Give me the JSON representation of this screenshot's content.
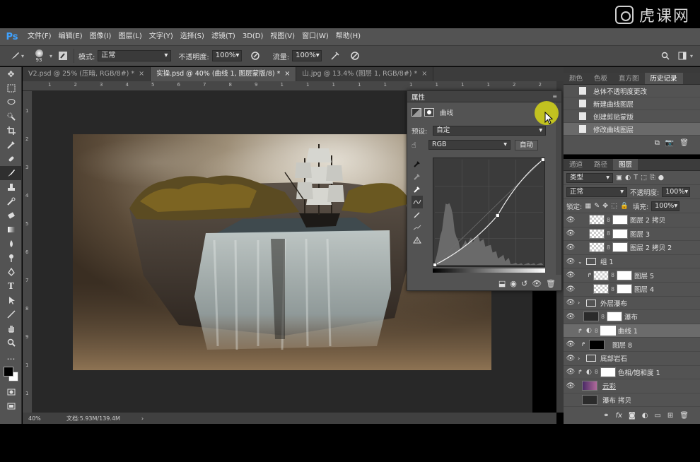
{
  "app": {
    "logo": "Ps",
    "watermark": "虎课网"
  },
  "menu": [
    "文件(F)",
    "编辑(E)",
    "图像(I)",
    "图层(L)",
    "文字(Y)",
    "选择(S)",
    "滤镜(T)",
    "3D(D)",
    "视图(V)",
    "窗口(W)",
    "帮助(H)"
  ],
  "options": {
    "brush_size": "93",
    "mode_label": "模式:",
    "mode_value": "正常",
    "opacity_label": "不透明度:",
    "opacity_value": "100%",
    "flow_label": "流量:",
    "flow_value": "100%"
  },
  "tabs": [
    {
      "label": "V2.psd @ 25% (压暗, RGB/8#) *",
      "close": "×"
    },
    {
      "label": "实操.psd @ 40% (曲线 1, 图层蒙版/8) *",
      "close": "×"
    },
    {
      "label": "山.jpg @ 13.4% (图层 1, RGB/8#) *",
      "close": "×"
    }
  ],
  "status": {
    "zoom": "40%",
    "doc": "文档:5.93M/139.4M",
    "arrow": "›"
  },
  "ruler": {
    "h": [
      "1",
      "2",
      "3",
      "4",
      "5",
      "6",
      "7",
      "8",
      "9",
      "1",
      "1",
      "1",
      "1",
      "1",
      "1",
      "1",
      "1",
      "1",
      "2",
      "2"
    ]
  },
  "properties": {
    "title": "属性",
    "type_label": "曲线",
    "preset_label": "预设:",
    "preset_value": "自定",
    "channel_value": "RGB",
    "auto_label": "自动",
    "curve_points": [
      [
        0,
        0
      ],
      [
        0.58,
        0.47
      ],
      [
        1,
        1
      ]
    ]
  },
  "history": {
    "tabs": [
      "颜色",
      "色板",
      "直方图",
      "历史记录"
    ],
    "items": [
      "总体不透明度更改",
      "新建曲线图层",
      "创建剪贴蒙版",
      "修改曲线图层"
    ]
  },
  "layers_panel": {
    "tabs": [
      "通道",
      "路径",
      "图层"
    ],
    "kind_label": "类型",
    "blend_mode": "正常",
    "opacity_label": "不透明度:",
    "opacity_value": "100%",
    "lock_label": "锁定:",
    "fill_label": "填充:",
    "fill_value": "100%",
    "layers": [
      {
        "name": "图层 2 拷贝"
      },
      {
        "name": "图层 3"
      },
      {
        "name": "图层 2 拷贝 2"
      },
      {
        "name": "组 1"
      },
      {
        "name": "图层 5"
      },
      {
        "name": "图层 4"
      },
      {
        "name": "外层瀑布"
      },
      {
        "name": "瀑布"
      },
      {
        "name": "曲线 1"
      },
      {
        "name": "图层 8"
      },
      {
        "name": "底部岩石"
      },
      {
        "name": "色相/饱和度 1"
      },
      {
        "name": "云彩"
      },
      {
        "name": "瀑布 拷贝"
      }
    ]
  }
}
